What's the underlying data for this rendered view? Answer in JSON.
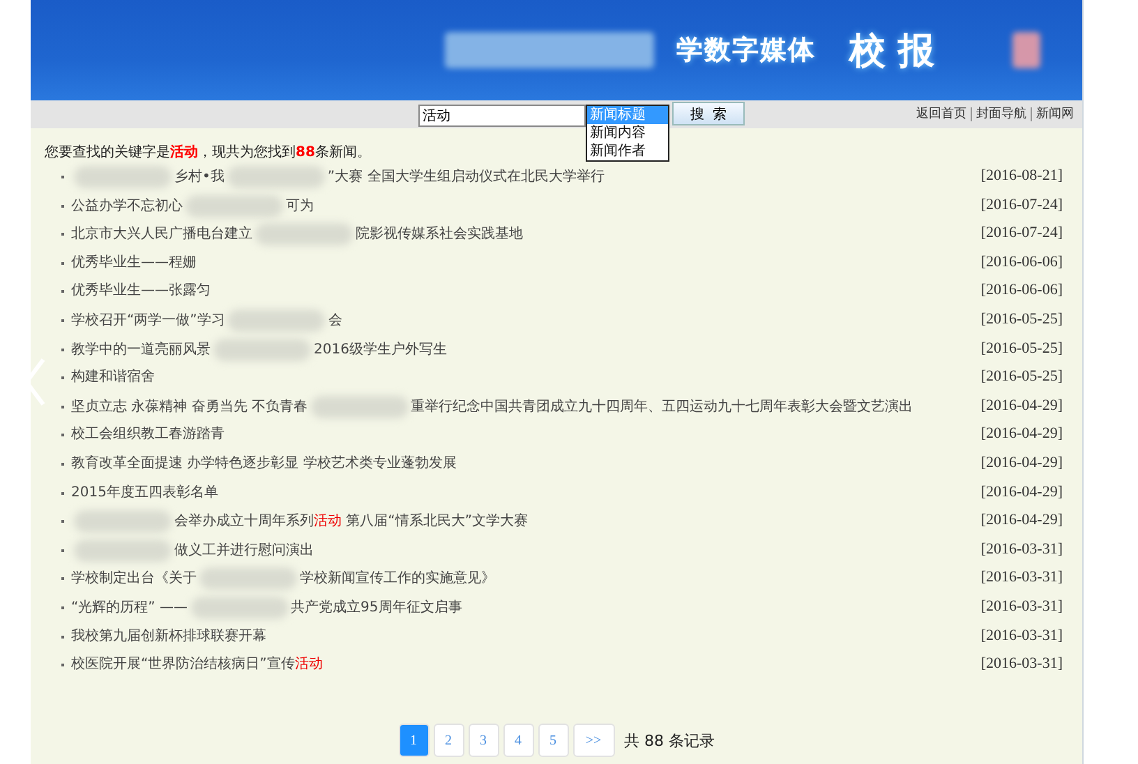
{
  "header": {
    "title_part": "学数字媒体",
    "title_main": "校 报"
  },
  "toolbar": {
    "search": {
      "value": "活动"
    },
    "field_options": [
      {
        "label": "新闻标题",
        "selected": true
      },
      {
        "label": "新闻内容",
        "selected": false
      },
      {
        "label": "新闻作者",
        "selected": false
      }
    ],
    "search_button": "搜  索",
    "links": [
      "返回首页",
      "封面导航",
      "新闻网"
    ]
  },
  "summary": {
    "prefix": "您要查找的关键字是",
    "keyword": "活动",
    "middle": "，现共为您找到",
    "count": "88",
    "suffix": "条新闻。"
  },
  "news": [
    {
      "title": [
        {
          "kind": "blur"
        },
        {
          "kind": "text",
          "text": "乡村•我"
        },
        {
          "kind": "blur"
        },
        {
          "kind": "text",
          "text": "”大赛 全国大学生组启动仪式在北民大学举行"
        }
      ],
      "date": "[2016-08-21]"
    },
    {
      "title": [
        {
          "kind": "text",
          "text": "公益办学不忘初心"
        },
        {
          "kind": "blur"
        },
        {
          "kind": "text",
          "text": "可为"
        }
      ],
      "date": "[2016-07-24]"
    },
    {
      "title": [
        {
          "kind": "text",
          "text": "北京市大兴人民广播电台建立"
        },
        {
          "kind": "blur"
        },
        {
          "kind": "text",
          "text": "院影视传媒系社会实践基地"
        }
      ],
      "date": "[2016-07-24]"
    },
    {
      "title": [
        {
          "kind": "text",
          "text": "优秀毕业生——程姗"
        }
      ],
      "date": "[2016-06-06]"
    },
    {
      "title": [
        {
          "kind": "text",
          "text": "优秀毕业生——张露匀"
        }
      ],
      "date": "[2016-06-06]"
    },
    {
      "title": [
        {
          "kind": "text",
          "text": "学校召开“两学一做”学习"
        },
        {
          "kind": "blur"
        },
        {
          "kind": "text",
          "text": "会"
        }
      ],
      "date": "[2016-05-25]"
    },
    {
      "title": [
        {
          "kind": "text",
          "text": "教学中的一道亮丽风景"
        },
        {
          "kind": "blur"
        },
        {
          "kind": "text",
          "text": "2016级学生户外写生"
        }
      ],
      "date": "[2016-05-25]"
    },
    {
      "title": [
        {
          "kind": "text",
          "text": "构建和谐宿舍"
        }
      ],
      "date": "[2016-05-25]"
    },
    {
      "title": [
        {
          "kind": "text",
          "text": "坚贞立志 永葆精神 奋勇当先 不负青春"
        },
        {
          "kind": "blur"
        },
        {
          "kind": "text",
          "text": "重举行纪念中国共青团成立九十四周年、五四运动九十七周年表彰大会暨文艺演出"
        }
      ],
      "date": "[2016-04-29]"
    },
    {
      "title": [
        {
          "kind": "text",
          "text": "校工会组织教工春游踏青"
        }
      ],
      "date": "[2016-04-29]"
    },
    {
      "title": [
        {
          "kind": "text",
          "text": "教育改革全面提速 办学特色逐步彰显 学校艺术类专业蓬勃发展"
        }
      ],
      "date": "[2016-04-29]"
    },
    {
      "title": [
        {
          "kind": "text",
          "text": "2015年度五四表彰名单"
        }
      ],
      "date": "[2016-04-29]"
    },
    {
      "title": [
        {
          "kind": "blur"
        },
        {
          "kind": "text",
          "text": "会举办成立十周年系列"
        },
        {
          "kind": "hit",
          "text": "活动"
        },
        {
          "kind": "text",
          "text": " 第八届“情系北民大”文学大赛"
        }
      ],
      "date": "[2016-04-29]"
    },
    {
      "title": [
        {
          "kind": "blur"
        },
        {
          "kind": "text",
          "text": "做义工并进行慰问演出"
        }
      ],
      "date": "[2016-03-31]"
    },
    {
      "title": [
        {
          "kind": "text",
          "text": "学校制定出台《关于"
        },
        {
          "kind": "blur"
        },
        {
          "kind": "text",
          "text": "学校新闻宣传工作的实施意见》"
        }
      ],
      "date": "[2016-03-31]"
    },
    {
      "title": [
        {
          "kind": "text",
          "text": "“光辉的历程” ——"
        },
        {
          "kind": "blur"
        },
        {
          "kind": "text",
          "text": "共产党成立95周年征文启事"
        }
      ],
      "date": "[2016-03-31]"
    },
    {
      "title": [
        {
          "kind": "text",
          "text": "我校第九届创新杯排球联赛开幕"
        }
      ],
      "date": "[2016-03-31]"
    },
    {
      "title": [
        {
          "kind": "text",
          "text": "校医院开展“世界防治结核病日”宣传"
        },
        {
          "kind": "hit",
          "text": "活动"
        }
      ],
      "date": "[2016-03-31]"
    }
  ],
  "pagination": {
    "pages": [
      {
        "label": "1",
        "selected": true
      },
      {
        "label": "2",
        "selected": false
      },
      {
        "label": "3",
        "selected": false
      },
      {
        "label": "4",
        "selected": false
      },
      {
        "label": "5",
        "selected": false
      }
    ],
    "next": ">>",
    "total": "共 88 条记录"
  }
}
